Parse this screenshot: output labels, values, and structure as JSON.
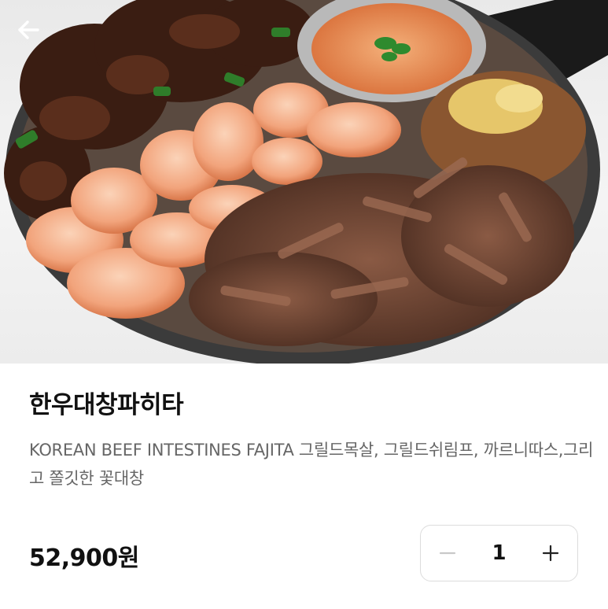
{
  "header": {
    "back_icon": "arrow-left-icon",
    "image_alt": "Korean beef intestines fajita platter"
  },
  "product": {
    "name": "한우대창파히타",
    "description": "KOREAN BEEF INTESTINES FAJITA 그릴드목살, 그릴드쉬림프, 까르니따스,그리고 쫄깃한 꽃대창",
    "price": "52,900원"
  },
  "quantity": {
    "value": "1",
    "decrement_icon": "minus-icon",
    "increment_icon": "plus-icon"
  }
}
